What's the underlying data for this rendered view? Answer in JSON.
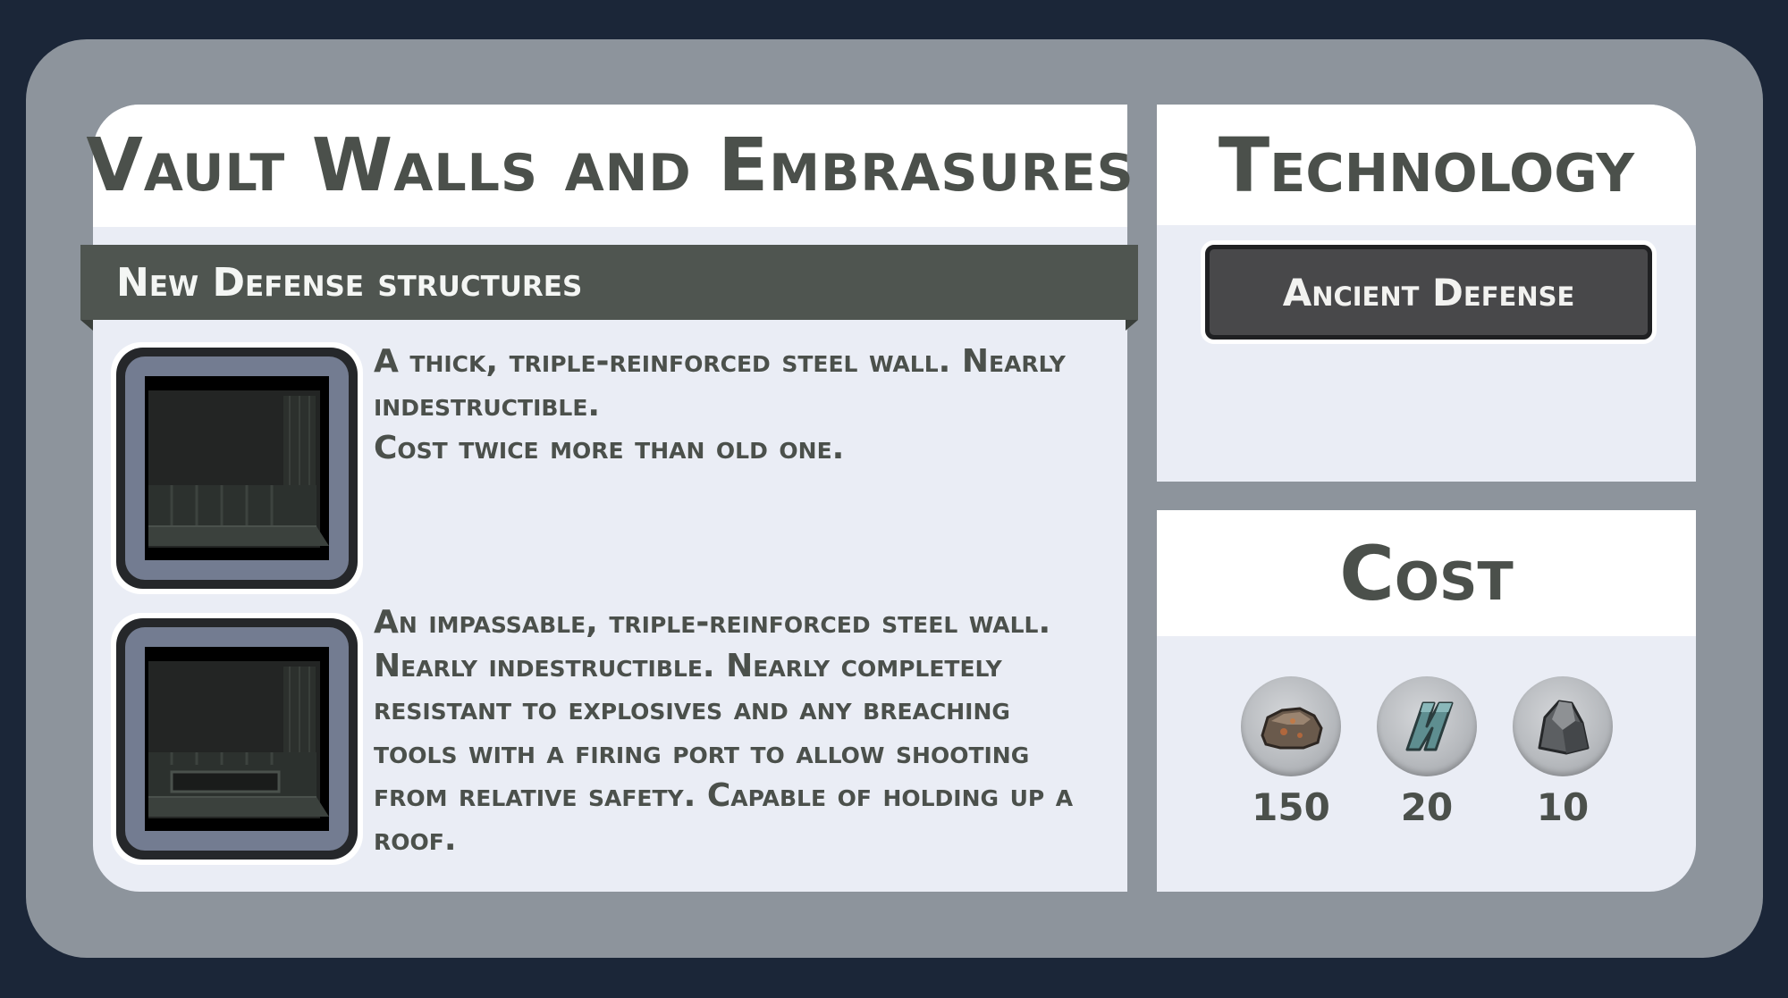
{
  "research": {
    "title": "Vault Walls and Embrasures"
  },
  "section": {
    "title": "New Defense structures"
  },
  "structures": [
    {
      "icon": "vault-wall-icon",
      "description": "A thick, triple-reinforced steel wall. Nearly\nindestructible.\nCost twice more than old one."
    },
    {
      "icon": "vault-embrasure-icon",
      "description": "An impassable, triple-reinforced steel wall.\nNearly indestructible. Nearly completely\nresistant to explosives and any breaching\ntools with a firing port to allow shooting\nfrom relative safety. Capable of holding up a\nroof."
    }
  ],
  "technology": {
    "title": "Technology",
    "items": [
      {
        "label": "Ancient Defense"
      }
    ]
  },
  "cost": {
    "title": "Cost",
    "resources": [
      {
        "icon": "ore-rock-icon",
        "amount": "150"
      },
      {
        "icon": "metal-bar-icon",
        "amount": "20"
      },
      {
        "icon": "stone-icon",
        "amount": "10"
      }
    ]
  },
  "colors": {
    "background": "#1b2638",
    "frame": "#8d949c",
    "panel": "#eaedf5",
    "banner": "#4f5550",
    "text": "#4b504b",
    "button": "#48484a"
  }
}
